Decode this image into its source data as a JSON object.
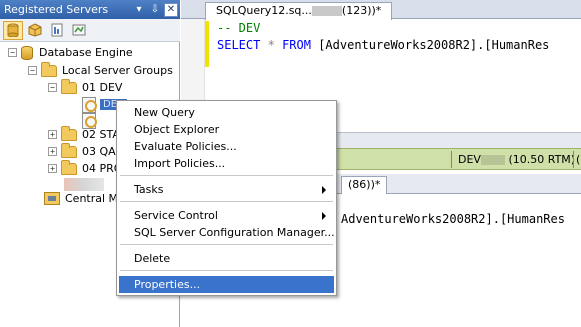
{
  "panel": {
    "title": "Registered Servers",
    "pin_glyph": "⇩",
    "dock_glyph": "▾",
    "close_glyph": "✕"
  },
  "tree": {
    "root": "Database Engine",
    "groups": "Local Server Groups",
    "dev": "01 DEV",
    "dev_server": "DEV",
    "stage": "02 STA",
    "qa": "03 QA",
    "prod": "04 PRO",
    "central": "Central Ma"
  },
  "editor": {
    "tab_title_prefix": "SQLQuery12.sq...",
    "tab_title_suffix": "(123))*",
    "line1": "-- DEV",
    "line2_kw1": "SELECT",
    "line2_kw2": "*",
    "line2_kw3": "FROM",
    "line2_obj": "[AdventureWorks2008R2].[HumanRes",
    "status_server": "DEV",
    "status_version": "(10.50 RTM)",
    "status_tail": "(",
    "tab2_title": "(86))*",
    "lower_line_obj": "AdventureWorks2008R2].[HumanRes"
  },
  "context_menu": {
    "new_query": "New Query",
    "object_explorer": "Object Explorer",
    "evaluate_policies": "Evaluate Policies...",
    "import_policies": "Import Policies...",
    "tasks": "Tasks",
    "service_control": "Service Control",
    "config_manager": "SQL Server Configuration Manager...",
    "delete": "Delete",
    "properties": "Properties..."
  },
  "colors": {
    "accent": "#3a73cc",
    "titlebar": "#2e5fa8",
    "status_bar": "#cfe0a9"
  }
}
